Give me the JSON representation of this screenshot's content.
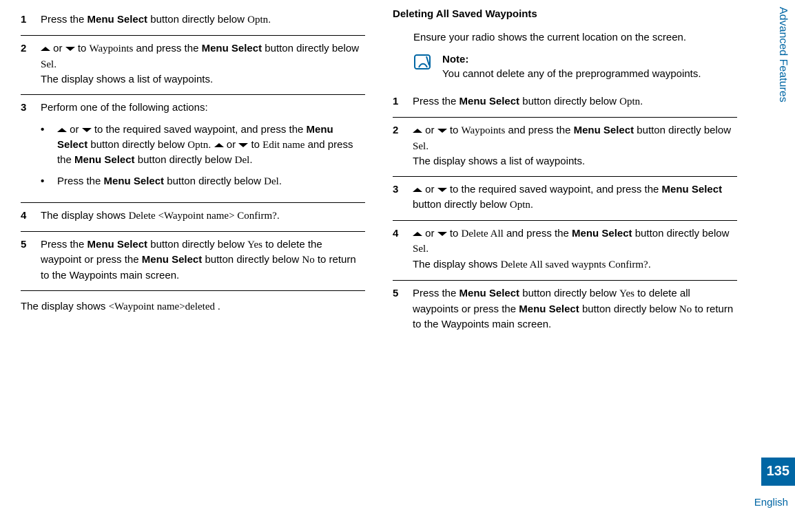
{
  "side": {
    "section": "Advanced Features",
    "page": "135",
    "lang": "English"
  },
  "left": {
    "step1": {
      "num": "1",
      "a": "Press the ",
      "b": "Menu Select",
      "c": " button directly below ",
      "d": "Optn",
      "e": "."
    },
    "step2": {
      "num": "2",
      "a": " or ",
      "b": " to ",
      "c": "Waypoints",
      "d": " and press the ",
      "e": "Menu Select",
      "f": " button directly below ",
      "g": "Sel",
      "h": ".",
      "i": "The display shows a list of waypoints."
    },
    "step3": {
      "num": "3",
      "a": "Perform one of the following actions:",
      "b1a": " or ",
      "b1b": " to the required saved waypoint, and press the ",
      "b1c": "Menu Select",
      "b1d": " button directly below ",
      "b1e": "Optn",
      "b1f": ". ",
      "b1g": " or ",
      "b1h": " to ",
      "b1i": "Edit name",
      "b1j": " and press the ",
      "b1k": "Menu Select",
      "b1l": " button directly below ",
      "b1m": "Del",
      "b1n": ".",
      "b2a": "Press the ",
      "b2b": "Menu Select",
      "b2c": " button directly below ",
      "b2d": "Del",
      "b2e": "."
    },
    "step4": {
      "num": "4",
      "a": "The display shows ",
      "b": "Delete <Waypoint name> Confirm?",
      "c": "."
    },
    "step5": {
      "num": "5",
      "a": "Press the ",
      "b": "Menu Select",
      "c": " button directly below ",
      "d": "Yes",
      "e": " to delete the waypoint or press the ",
      "f": "Menu Select",
      "g": " button directly below ",
      "h": "No",
      "i": " to return to the Waypoints main screen."
    },
    "after": {
      "a": "The display shows ",
      "b": "<Waypoint name>deleted ",
      "c": "."
    }
  },
  "right": {
    "heading": "Deleting All Saved Waypoints",
    "intro": "Ensure your radio shows the current location on the screen.",
    "note": {
      "title": "Note:",
      "body": "You cannot delete any of the preprogrammed waypoints."
    },
    "step1": {
      "num": "1",
      "a": "Press the ",
      "b": "Menu Select",
      "c": " button directly below ",
      "d": "Optn",
      "e": "."
    },
    "step2": {
      "num": "2",
      "a": " or ",
      "b": " to ",
      "c": "Waypoints",
      "d": " and press the ",
      "e": "Menu Select",
      "f": " button directly below ",
      "g": "Sel",
      "h": ".",
      "i": "The display shows a list of waypoints."
    },
    "step3": {
      "num": "3",
      "a": " or ",
      "b": " to the required saved waypoint, and press the ",
      "c": "Menu Select",
      "d": " button directly below ",
      "e": "Optn",
      "f": "."
    },
    "step4": {
      "num": "4",
      "a": " or ",
      "b": " to ",
      "c": "Delete All",
      "d": " and press the ",
      "e": "Menu Select",
      "f": " button directly below ",
      "g": "Sel",
      "h": ".",
      "i": "The display shows ",
      "j": "Delete All saved waypnts Confirm?",
      "k": "."
    },
    "step5": {
      "num": "5",
      "a": "Press the ",
      "b": "Menu Select",
      "c": " button directly below ",
      "d": "Yes",
      "e": " to delete all waypoints or press the ",
      "f": "Menu Select",
      "g": " button directly below ",
      "h": "No",
      "i": " to return to the Waypoints main screen."
    }
  }
}
